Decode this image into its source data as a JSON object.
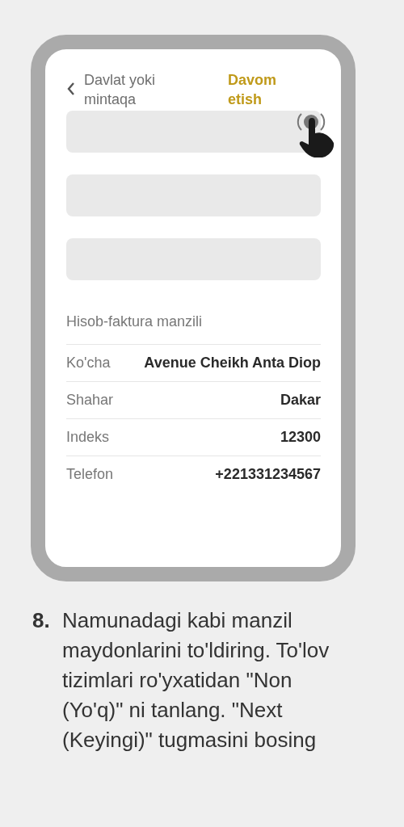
{
  "header": {
    "title": "Davlat yoki mintaqa",
    "action": "Davom etish"
  },
  "fields": [
    {
      "kind": "input",
      "tapped": true
    },
    {
      "kind": "input",
      "tapped": false
    },
    {
      "kind": "input",
      "tapped": false
    }
  ],
  "section": {
    "title": "Hisob-faktura manzili"
  },
  "address": [
    {
      "label": "Ko'cha",
      "value": "Avenue Cheikh Anta Diop"
    },
    {
      "label": "Shahar",
      "value": "Dakar"
    },
    {
      "label": "Indeks",
      "value": "12300"
    },
    {
      "label": "Telefon",
      "value": "+221331234567"
    }
  ],
  "step": {
    "number": "8.",
    "text": "Namunadagi kabi manzil maydonlarini to'ldiring. To'lov tizimlari ro'yxatidan \"Non (Yo'q)\" ni tanlang. \"Next (Keyingi)\" tugmasini bosing"
  }
}
